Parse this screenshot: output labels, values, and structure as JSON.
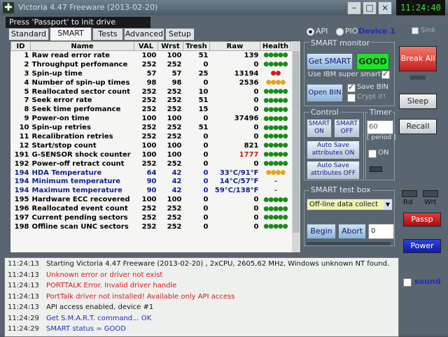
{
  "window": {
    "title": "Victoria 4.47 Freeware (2013-02-20)",
    "clock": "11:24:40",
    "logo_glyph": "✚"
  },
  "hint": "Press 'Passport' to init drive",
  "tabs": [
    {
      "label": "Standard"
    },
    {
      "label": "SMART"
    },
    {
      "label": "Tests"
    },
    {
      "label": "Advanced"
    },
    {
      "label": "Setup"
    }
  ],
  "mode": {
    "api_label": "API",
    "pio_label": "PIO",
    "device_label": "Device 1",
    "sink_label": "Sink"
  },
  "table": {
    "headers": [
      "ID",
      "Name",
      "VAL",
      "Wrst",
      "Tresh",
      "Raw",
      "Health"
    ],
    "rows": [
      {
        "id": "1",
        "name": "Raw read error rate",
        "val": "100",
        "wrst": "100",
        "tresh": "51",
        "raw": "139",
        "health": "●●●●●",
        "hc": "#1a8a1a",
        "blue": false,
        "rawc": ""
      },
      {
        "id": "2",
        "name": "Throughput perfomance",
        "val": "252",
        "wrst": "252",
        "tresh": "0",
        "raw": "0",
        "health": "●●●●●",
        "hc": "#1a8a1a",
        "blue": false,
        "rawc": ""
      },
      {
        "id": "3",
        "name": "Spin-up time",
        "val": "57",
        "wrst": "57",
        "tresh": "25",
        "raw": "13194",
        "health": "●●",
        "hc": "#d41a1a",
        "blue": false,
        "rawc": ""
      },
      {
        "id": "4",
        "name": "Number of spin-up times",
        "val": "98",
        "wrst": "98",
        "tresh": "0",
        "raw": "2536",
        "health": "●●●●",
        "hc": "#e8a21a",
        "blue": false,
        "rawc": ""
      },
      {
        "id": "5",
        "name": "Reallocated sector count",
        "val": "252",
        "wrst": "252",
        "tresh": "10",
        "raw": "0",
        "health": "●●●●●",
        "hc": "#1a8a1a",
        "blue": false,
        "rawc": ""
      },
      {
        "id": "7",
        "name": "Seek error rate",
        "val": "252",
        "wrst": "252",
        "tresh": "51",
        "raw": "0",
        "health": "●●●●●",
        "hc": "#1a8a1a",
        "blue": false,
        "rawc": ""
      },
      {
        "id": "8",
        "name": "Seek time perfomance",
        "val": "252",
        "wrst": "252",
        "tresh": "15",
        "raw": "0",
        "health": "●●●●●",
        "hc": "#1a8a1a",
        "blue": false,
        "rawc": ""
      },
      {
        "id": "9",
        "name": "Power-on time",
        "val": "100",
        "wrst": "100",
        "tresh": "0",
        "raw": "37496",
        "health": "●●●●●",
        "hc": "#1a8a1a",
        "blue": false,
        "rawc": ""
      },
      {
        "id": "10",
        "name": "Spin-up retries",
        "val": "252",
        "wrst": "252",
        "tresh": "51",
        "raw": "0",
        "health": "●●●●●",
        "hc": "#1a8a1a",
        "blue": false,
        "rawc": ""
      },
      {
        "id": "11",
        "name": "Recalibration retries",
        "val": "252",
        "wrst": "252",
        "tresh": "0",
        "raw": "0",
        "health": "●●●●●",
        "hc": "#1a8a1a",
        "blue": false,
        "rawc": ""
      },
      {
        "id": "12",
        "name": "Start/stop count",
        "val": "100",
        "wrst": "100",
        "tresh": "0",
        "raw": "821",
        "health": "●●●●●",
        "hc": "#1a8a1a",
        "blue": false,
        "rawc": ""
      },
      {
        "id": "191",
        "name": "G-SENSOR shock counter",
        "val": "100",
        "wrst": "100",
        "tresh": "0",
        "raw": "1777",
        "health": "●●●●●",
        "hc": "#1a8a1a",
        "blue": false,
        "rawc": "#d41a1a"
      },
      {
        "id": "192",
        "name": "Power-off retract count",
        "val": "252",
        "wrst": "252",
        "tresh": "0",
        "raw": "0",
        "health": "●●●●●",
        "hc": "#1a8a1a",
        "blue": false,
        "rawc": ""
      },
      {
        "id": "194",
        "name": "HDA Temperature",
        "val": "64",
        "wrst": "42",
        "tresh": "0",
        "raw": "33°C/91°F",
        "health": "●●●●",
        "hc": "#e8a21a",
        "blue": true,
        "rawc": ""
      },
      {
        "id": "194",
        "name": "Minimum temperature",
        "val": "90",
        "wrst": "42",
        "tresh": "0",
        "raw": "14°C/57°F",
        "health": "-",
        "hc": "#333",
        "blue": true,
        "rawc": ""
      },
      {
        "id": "194",
        "name": "Maximum temperature",
        "val": "90",
        "wrst": "42",
        "tresh": "0",
        "raw": "59°C/138°F",
        "health": "-",
        "hc": "#333",
        "blue": true,
        "rawc": ""
      },
      {
        "id": "195",
        "name": "Hardware ECC recovered",
        "val": "100",
        "wrst": "100",
        "tresh": "0",
        "raw": "0",
        "health": "●●●●●",
        "hc": "#1a8a1a",
        "blue": false,
        "rawc": ""
      },
      {
        "id": "196",
        "name": "Reallocated event count",
        "val": "252",
        "wrst": "252",
        "tresh": "0",
        "raw": "0",
        "health": "●●●●●",
        "hc": "#1a8a1a",
        "blue": false,
        "rawc": ""
      },
      {
        "id": "197",
        "name": "Current pending sectors",
        "val": "252",
        "wrst": "252",
        "tresh": "0",
        "raw": "0",
        "health": "●●●●●",
        "hc": "#1a8a1a",
        "blue": false,
        "rawc": ""
      },
      {
        "id": "198",
        "name": "Offline scan UNC sectors",
        "val": "252",
        "wrst": "252",
        "tresh": "0",
        "raw": "0",
        "health": "●●●●●",
        "hc": "#1a8a1a",
        "blue": false,
        "rawc": ""
      }
    ]
  },
  "smart_monitor": {
    "title": "SMART monitor",
    "get_smart": "Get SMART",
    "status": "GOOD",
    "ibm_label": "Use IBM super smart:",
    "open_bin": "Open BIN",
    "save_bin": "Save BIN",
    "crypt_it": "Crypt it!"
  },
  "control": {
    "title": "Control",
    "smart_on": "SMART ON",
    "smart_off": "SMART OFF",
    "autosave_on": "Auto Save attributes ON",
    "autosave_off": "Auto Save attributes OFF"
  },
  "timer": {
    "title": "Timer",
    "value": "60",
    "period": "[ period ]",
    "on_label": "ON"
  },
  "test_box": {
    "title": "SMART test box",
    "selected": "Off-line data collect",
    "begin": "Begin",
    "abort": "Abort",
    "value": "0"
  },
  "right": {
    "break_all": "Break All",
    "sleep": "Sleep",
    "recall": "Recall",
    "rd": "Rd",
    "wrt": "Wrt",
    "passp": "Passp",
    "power": "Power",
    "sound": "sound"
  },
  "log": [
    {
      "time": "11:24:13",
      "text": "Starting Victoria 4.47  Freeware (2013-02-20) , 2xCPU, 2605,62 MHz, Windows unknown NT found.",
      "color": "#111111"
    },
    {
      "time": "11:24:13",
      "text": "Unknown error or driver not exist",
      "color": "#d41a1a"
    },
    {
      "time": "11:24:13",
      "text": "PORTTALK Error. Invalid driver handle",
      "color": "#d41a1a"
    },
    {
      "time": "11:24:13",
      "text": "PortTalk driver not installed! Available only API access",
      "color": "#d41a1a"
    },
    {
      "time": "11:24:13",
      "text": "API access enabled, device #1",
      "color": "#111111"
    },
    {
      "time": "11:24:29",
      "text": "Get S.M.A.R.T. command... OK",
      "color": "#1c2fbf"
    },
    {
      "time": "11:24:29",
      "text": "SMART status = GOOD",
      "color": "#1c2fbf"
    }
  ]
}
